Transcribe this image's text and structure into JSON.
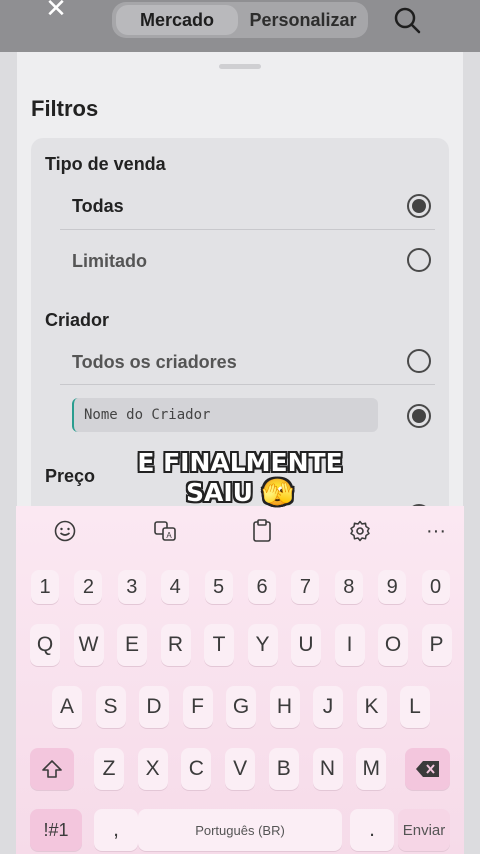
{
  "topbar": {
    "close_icon": "close-icon",
    "tabs": [
      {
        "label": "Mercado",
        "active": true
      },
      {
        "label": "Personalizar",
        "active": false
      }
    ],
    "search_icon": "search-icon"
  },
  "sheet": {
    "title": "Filtros",
    "sale_type": {
      "title": "Tipo de venda",
      "options": [
        {
          "label": "Todas",
          "selected": true
        },
        {
          "label": "Limitado",
          "selected": false
        }
      ]
    },
    "creator": {
      "title": "Criador",
      "all_label": "Todos os criadores",
      "all_selected": false,
      "input_placeholder": "Nome do Criador",
      "input_selected": true
    },
    "price": {
      "title": "Preço"
    }
  },
  "overlay": {
    "line1": "E FINALMENTE",
    "line2": "SAIU",
    "emoji": "🫣"
  },
  "keyboard": {
    "toolbar": [
      "emoji-icon",
      "translate-icon",
      "clipboard-icon",
      "settings-icon",
      "more-icon"
    ],
    "more_label": "···",
    "row_numbers": [
      "1",
      "2",
      "3",
      "4",
      "5",
      "6",
      "7",
      "8",
      "9",
      "0"
    ],
    "row1": [
      "Q",
      "W",
      "E",
      "R",
      "T",
      "Y",
      "U",
      "I",
      "O",
      "P"
    ],
    "row2": [
      "A",
      "S",
      "D",
      "F",
      "G",
      "H",
      "J",
      "K",
      "L"
    ],
    "row3": [
      "Z",
      "X",
      "C",
      "V",
      "B",
      "N",
      "M"
    ],
    "symbols_label": "!#1",
    "comma_label": ",",
    "space_label": "Português (BR)",
    "period_label": ".",
    "enter_label": "Enviar",
    "colors": {
      "background": "#fbe8f2",
      "key": "#fbeef5",
      "accent_key": "#f3c6dd"
    }
  }
}
